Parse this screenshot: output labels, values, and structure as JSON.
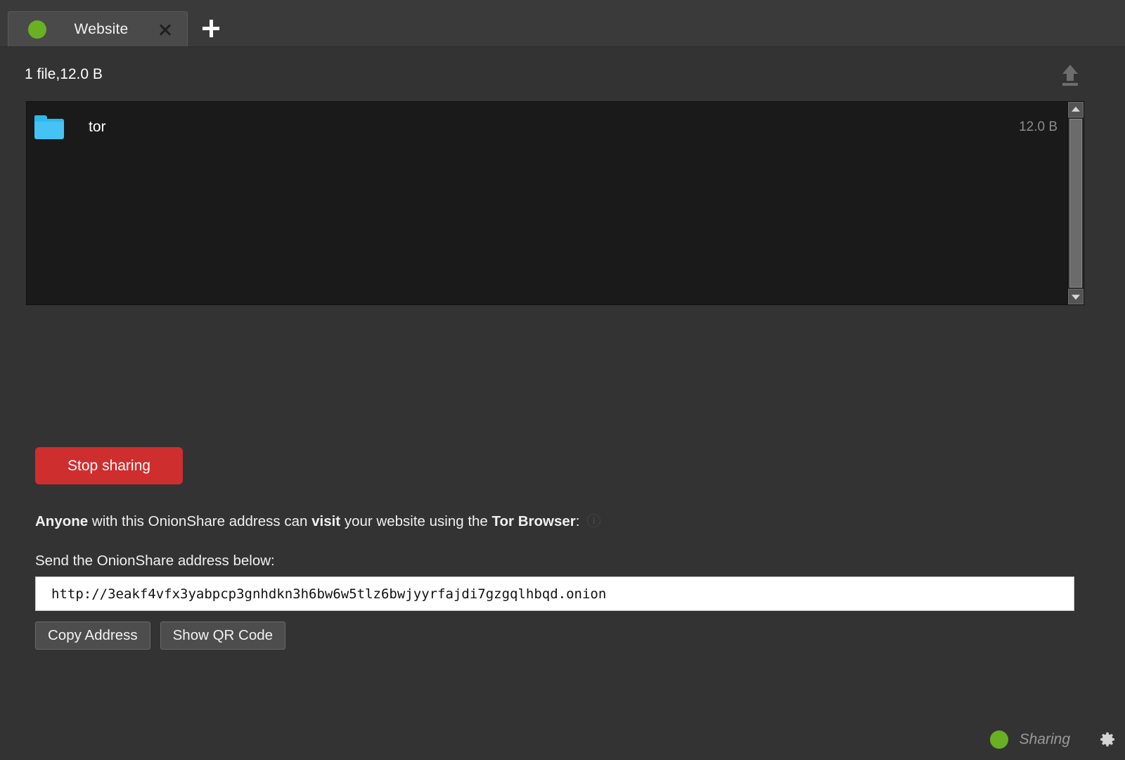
{
  "app": {
    "window_bg": "#333333",
    "accent_red": "#cf2e2e",
    "status_green": "#6ab023"
  },
  "tabbar": {
    "tabs": [
      {
        "label": "Website",
        "status_dot_color": "#6ab023",
        "close_icon": "close-icon"
      }
    ],
    "add_tab_icon": "plus-icon"
  },
  "file_header": {
    "summary": "1 file,12.0 B",
    "upload_icon": "upload-icon"
  },
  "file_list": {
    "items": [
      {
        "name": "tor",
        "size": "12.0 B",
        "icon": "folder-icon"
      }
    ],
    "scrollbar": {
      "up_icon": "chevron-up-icon",
      "down_icon": "chevron-down-icon"
    }
  },
  "actions": {
    "stop_sharing_label": "Stop sharing",
    "copy_address_label": "Copy Address",
    "show_qr_label": "Show QR Code"
  },
  "info": {
    "lead_bold": "Anyone",
    "mid_1": " with this OnionShare address can ",
    "visit_bold": "visit",
    "mid_2": " your website using the ",
    "tor_bold": "Tor Browser",
    "tail": ":",
    "help_icon": "info-icon",
    "send_label": "Send the OnionShare address below:"
  },
  "address": {
    "value": "http://3eakf4vfx3yabpcp3gnhdkn3h6bw6w5tlz6bwjyyrfajdi7gzgqlhbqd.onion",
    "placeholder": ""
  },
  "statusbar": {
    "status_text": "Sharing",
    "status_dot_color": "#6ab023",
    "settings_icon": "gear-icon"
  }
}
